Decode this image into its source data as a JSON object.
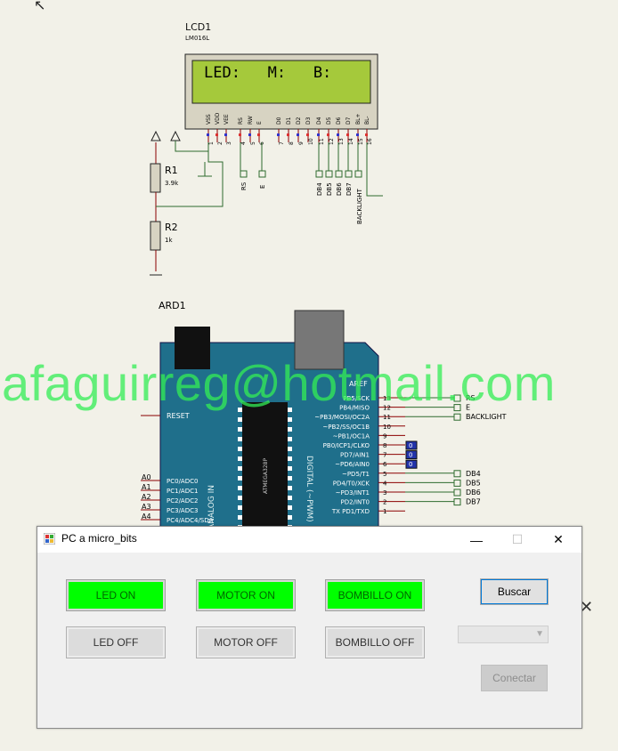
{
  "schematic": {
    "lcd_ref": "LCD1",
    "lcd_model": "LM016L",
    "lcd_display_text": "LED:   M:   B:",
    "lcd_pins": [
      "VSS",
      "VDD",
      "VEE",
      "RS",
      "RW",
      "E",
      "D0",
      "D1",
      "D2",
      "D3",
      "D4",
      "D5",
      "D6",
      "D7",
      "BL+",
      "BL-"
    ],
    "lcd_pin_numbers": [
      "1",
      "2",
      "3",
      "4",
      "5",
      "6",
      "7",
      "8",
      "9",
      "10",
      "11",
      "12",
      "13",
      "14",
      "15",
      "16"
    ],
    "r1_ref": "R1",
    "r1_value": "3.9k",
    "r2_ref": "R2",
    "r2_value": "1k",
    "net_rs": "RS",
    "net_e": "E",
    "net_db4": "DB4",
    "net_db5": "DB5",
    "net_db6": "DB6",
    "net_db7": "DB7",
    "net_backlight": "BACKLIGHT",
    "ard_ref": "ARD1",
    "ard_aref": "AREF",
    "ard_reset": "RESET",
    "ard_analog": "ANALOG IN",
    "ard_digital": "DIGITAL (~PWM)",
    "ard_chip": "ATMEGA328P",
    "ard_left_pins": [
      "PC0/ADC0",
      "PC1/ADC1",
      "PC2/ADC2",
      "PC3/ADC3",
      "PC4/ADC4/SDA"
    ],
    "ard_a_labels": [
      "A0",
      "A1",
      "A2",
      "A3",
      "A4"
    ],
    "ard_right_pins": [
      "PB5/SCK",
      "PB4/MISO",
      "~PB3/MOSI/OC2A",
      "~PB2/SS/OC1B",
      "~PB1/OC1A",
      "PB0/ICP1/CLKO",
      "PD7/AIN1",
      "~PD6/AIN0",
      "~PD5/T1",
      "PD4/T0/XCK",
      "~PD3/INT1",
      "PD2/INT0",
      "TX PD1/TXD"
    ],
    "ard_right_nums": [
      "13",
      "12",
      "11",
      "10",
      "9",
      "8",
      "7",
      "6",
      "5",
      "4",
      "3",
      "2",
      "1"
    ],
    "right_nets": [
      "RS",
      "E",
      "BACKLIGHT",
      "",
      "",
      "",
      "",
      "",
      "DB4",
      "DB5",
      "DB6",
      "DB7",
      ""
    ],
    "probe_value": "0",
    "watermark": "afaguirreg@hotmail.com"
  },
  "dialog": {
    "title": "PC a micro_bits",
    "minimize": "—",
    "maximize": "☐",
    "close": "✕",
    "buttons_on": [
      "LED ON",
      "MOTOR ON",
      "BOMBILLO ON"
    ],
    "buttons_off": [
      "LED OFF",
      "MOTOR OFF",
      "BOMBILLO OFF"
    ],
    "search_label": "Buscar",
    "connect_label": "Conectar",
    "port_combo_value": "",
    "colors": {
      "on": "#00ff00",
      "off": "#dcdcdc",
      "accent": "#0078d7"
    }
  },
  "outside_close": "✕"
}
